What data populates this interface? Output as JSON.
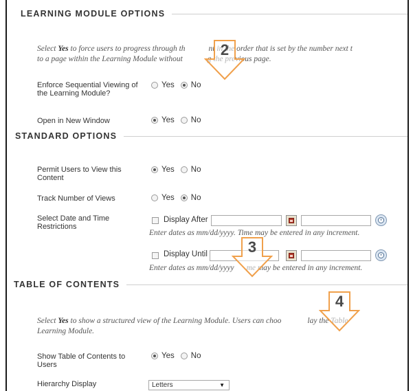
{
  "sections": {
    "learning": {
      "title": "LEARNING MODULE OPTIONS",
      "instr_pre": "Select ",
      "instr_bold": "Yes",
      "instr_line1_rest": " to force users to progress through th",
      "instr_line1_tail": "nt in the order that is set by the number next t",
      "instr_line2_head": "to a page within the Learning Module without",
      "instr_line2_tail": "g the previous page."
    },
    "standard": {
      "title": "STANDARD OPTIONS"
    },
    "toc": {
      "title": "TABLE OF CONTENTS",
      "instr_pre": "Select ",
      "instr_bold": "Yes",
      "instr_line1_rest": " to show a structured view of the Learning Module. Users can choo",
      "instr_line1_tail": "lay the Table",
      "instr_line2": "Learning Module."
    }
  },
  "fields": {
    "enforce": {
      "label": "Enforce Sequential Viewing of the Learning Module?",
      "yes": "Yes",
      "no": "No",
      "selected": "No"
    },
    "new_window": {
      "label": "Open in New Window",
      "yes": "Yes",
      "no": "No",
      "selected": "Yes"
    },
    "permit": {
      "label": "Permit Users to View this Content",
      "yes": "Yes",
      "no": "No",
      "selected": "Yes"
    },
    "track": {
      "label": "Track Number of Views",
      "yes": "Yes",
      "no": "No",
      "selected": "No"
    },
    "date_restrict": {
      "label": "Select Date and Time Restrictions",
      "display_after": "Display After",
      "display_until": "Display Until",
      "hint_after": "Enter dates as mm/dd/yyyy. Time may be entered in any increment.",
      "hint_until_head": "Enter dates as mm/dd/yyyy",
      "hint_until_tail": "me may be entered in any increment."
    },
    "show_toc": {
      "label": "Show Table of Contents to Users",
      "yes": "Yes",
      "no": "No",
      "selected": "Yes"
    },
    "hierarchy": {
      "label": "Hierarchy Display",
      "value": "Letters"
    }
  },
  "callouts": {
    "c2": "2",
    "c3": "3",
    "c4": "4"
  },
  "icons": {
    "calendar": "calendar-icon",
    "clock": "clock-icon",
    "chevron": "chevron-down-icon"
  },
  "colors": {
    "callout_orange": "#f0a04b",
    "border": "#1a1a1a"
  }
}
